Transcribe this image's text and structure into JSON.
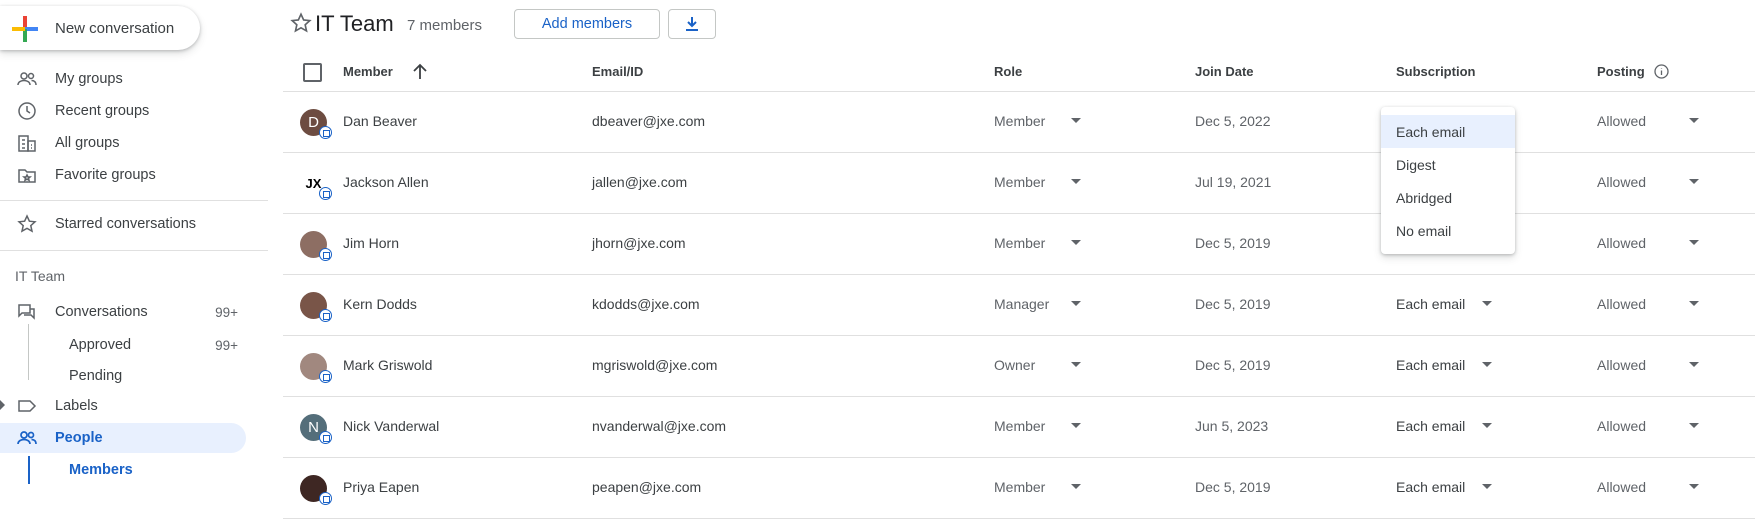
{
  "sidebar": {
    "compose_label": "New conversation",
    "nav": [
      {
        "label": "My groups",
        "icon": "people-icon"
      },
      {
        "label": "Recent groups",
        "icon": "clock-icon"
      },
      {
        "label": "All groups",
        "icon": "building-icon"
      },
      {
        "label": "Favorite groups",
        "icon": "folder-star-icon"
      }
    ],
    "starred_label": "Starred conversations",
    "group_section": "IT Team",
    "conversations": {
      "label": "Conversations",
      "count": "99+"
    },
    "approved": {
      "label": "Approved",
      "count": "99+"
    },
    "pending": {
      "label": "Pending"
    },
    "labels": {
      "label": "Labels"
    },
    "people": {
      "label": "People"
    },
    "members": {
      "label": "Members"
    }
  },
  "header": {
    "title": "IT Team",
    "members_count": "7 members",
    "add_members_label": "Add members"
  },
  "table": {
    "columns": {
      "member": "Member",
      "email": "Email/ID",
      "role": "Role",
      "join_date": "Join Date",
      "subscription": "Subscription",
      "posting": "Posting"
    },
    "rows": [
      {
        "name": "Dan Beaver",
        "initial": "D",
        "avatar_color": "#6d4c41",
        "email": "dbeaver@jxe.com",
        "role": "Member",
        "join": "Dec 5, 2022",
        "subscription": "",
        "posting": "Allowed"
      },
      {
        "name": "Jackson Allen",
        "initial": "JX",
        "avatar_color": "#ffffff",
        "email": "jallen@jxe.com",
        "role": "Member",
        "join": "Jul 19, 2021",
        "subscription": "",
        "posting": "Allowed"
      },
      {
        "name": "Jim Horn",
        "initial": "",
        "avatar_color": "#8d6e63",
        "email": "jhorn@jxe.com",
        "role": "Member",
        "join": "Dec 5, 2019",
        "subscription": "",
        "posting": "Allowed"
      },
      {
        "name": "Kern Dodds",
        "initial": "",
        "avatar_color": "#795548",
        "email": "kdodds@jxe.com",
        "role": "Manager",
        "join": "Dec 5, 2019",
        "subscription": "Each email",
        "posting": "Allowed"
      },
      {
        "name": "Mark Griswold",
        "initial": "",
        "avatar_color": "#a1887f",
        "email": "mgriswold@jxe.com",
        "role": "Owner",
        "join": "Dec 5, 2019",
        "subscription": "Each email",
        "posting": "Allowed"
      },
      {
        "name": "Nick Vanderwal",
        "initial": "N",
        "avatar_color": "#546e7a",
        "email": "nvanderwal@jxe.com",
        "role": "Member",
        "join": "Jun 5, 2023",
        "subscription": "Each email",
        "posting": "Allowed"
      },
      {
        "name": "Priya Eapen",
        "initial": "",
        "avatar_color": "#3e2723",
        "email": "peapen@jxe.com",
        "role": "Member",
        "join": "Dec 5, 2019",
        "subscription": "Each email",
        "posting": "Allowed"
      }
    ]
  },
  "subscription_menu": {
    "options": [
      "Each email",
      "Digest",
      "Abridged",
      "No email"
    ],
    "highlighted": "Each email"
  },
  "colors": {
    "accent": "#1a62c7",
    "active_bg": "#e8f0fe"
  }
}
